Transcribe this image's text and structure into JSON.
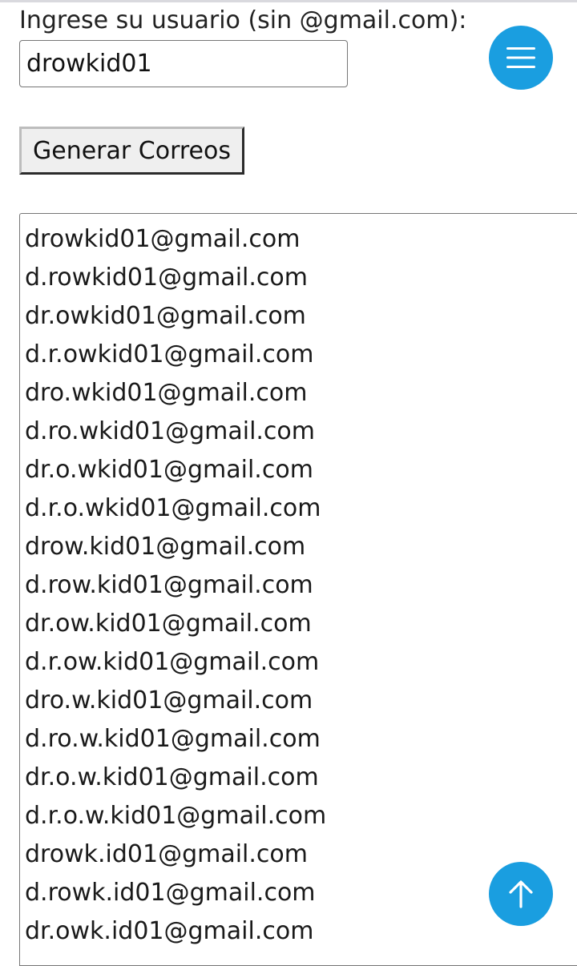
{
  "form": {
    "label": "Ingrese su usuario (sin @gmail.com):",
    "username_value": "drowkid01",
    "generate_label": "Generar Correos"
  },
  "results": {
    "emails": [
      "drowkid01@gmail.com",
      "d.rowkid01@gmail.com",
      "dr.owkid01@gmail.com",
      "d.r.owkid01@gmail.com",
      "dro.wkid01@gmail.com",
      "d.ro.wkid01@gmail.com",
      "dr.o.wkid01@gmail.com",
      "d.r.o.wkid01@gmail.com",
      "drow.kid01@gmail.com",
      "d.row.kid01@gmail.com",
      "dr.ow.kid01@gmail.com",
      "d.r.ow.kid01@gmail.com",
      "dro.w.kid01@gmail.com",
      "d.ro.w.kid01@gmail.com",
      "dr.o.w.kid01@gmail.com",
      "d.r.o.w.kid01@gmail.com",
      "drowk.id01@gmail.com",
      "d.rowk.id01@gmail.com",
      "dr.owk.id01@gmail.com"
    ]
  },
  "buttons": {
    "menu_icon": "hamburger-menu-icon",
    "scroll_top_icon": "arrow-up-icon",
    "accent_color": "#1a9ee0"
  }
}
